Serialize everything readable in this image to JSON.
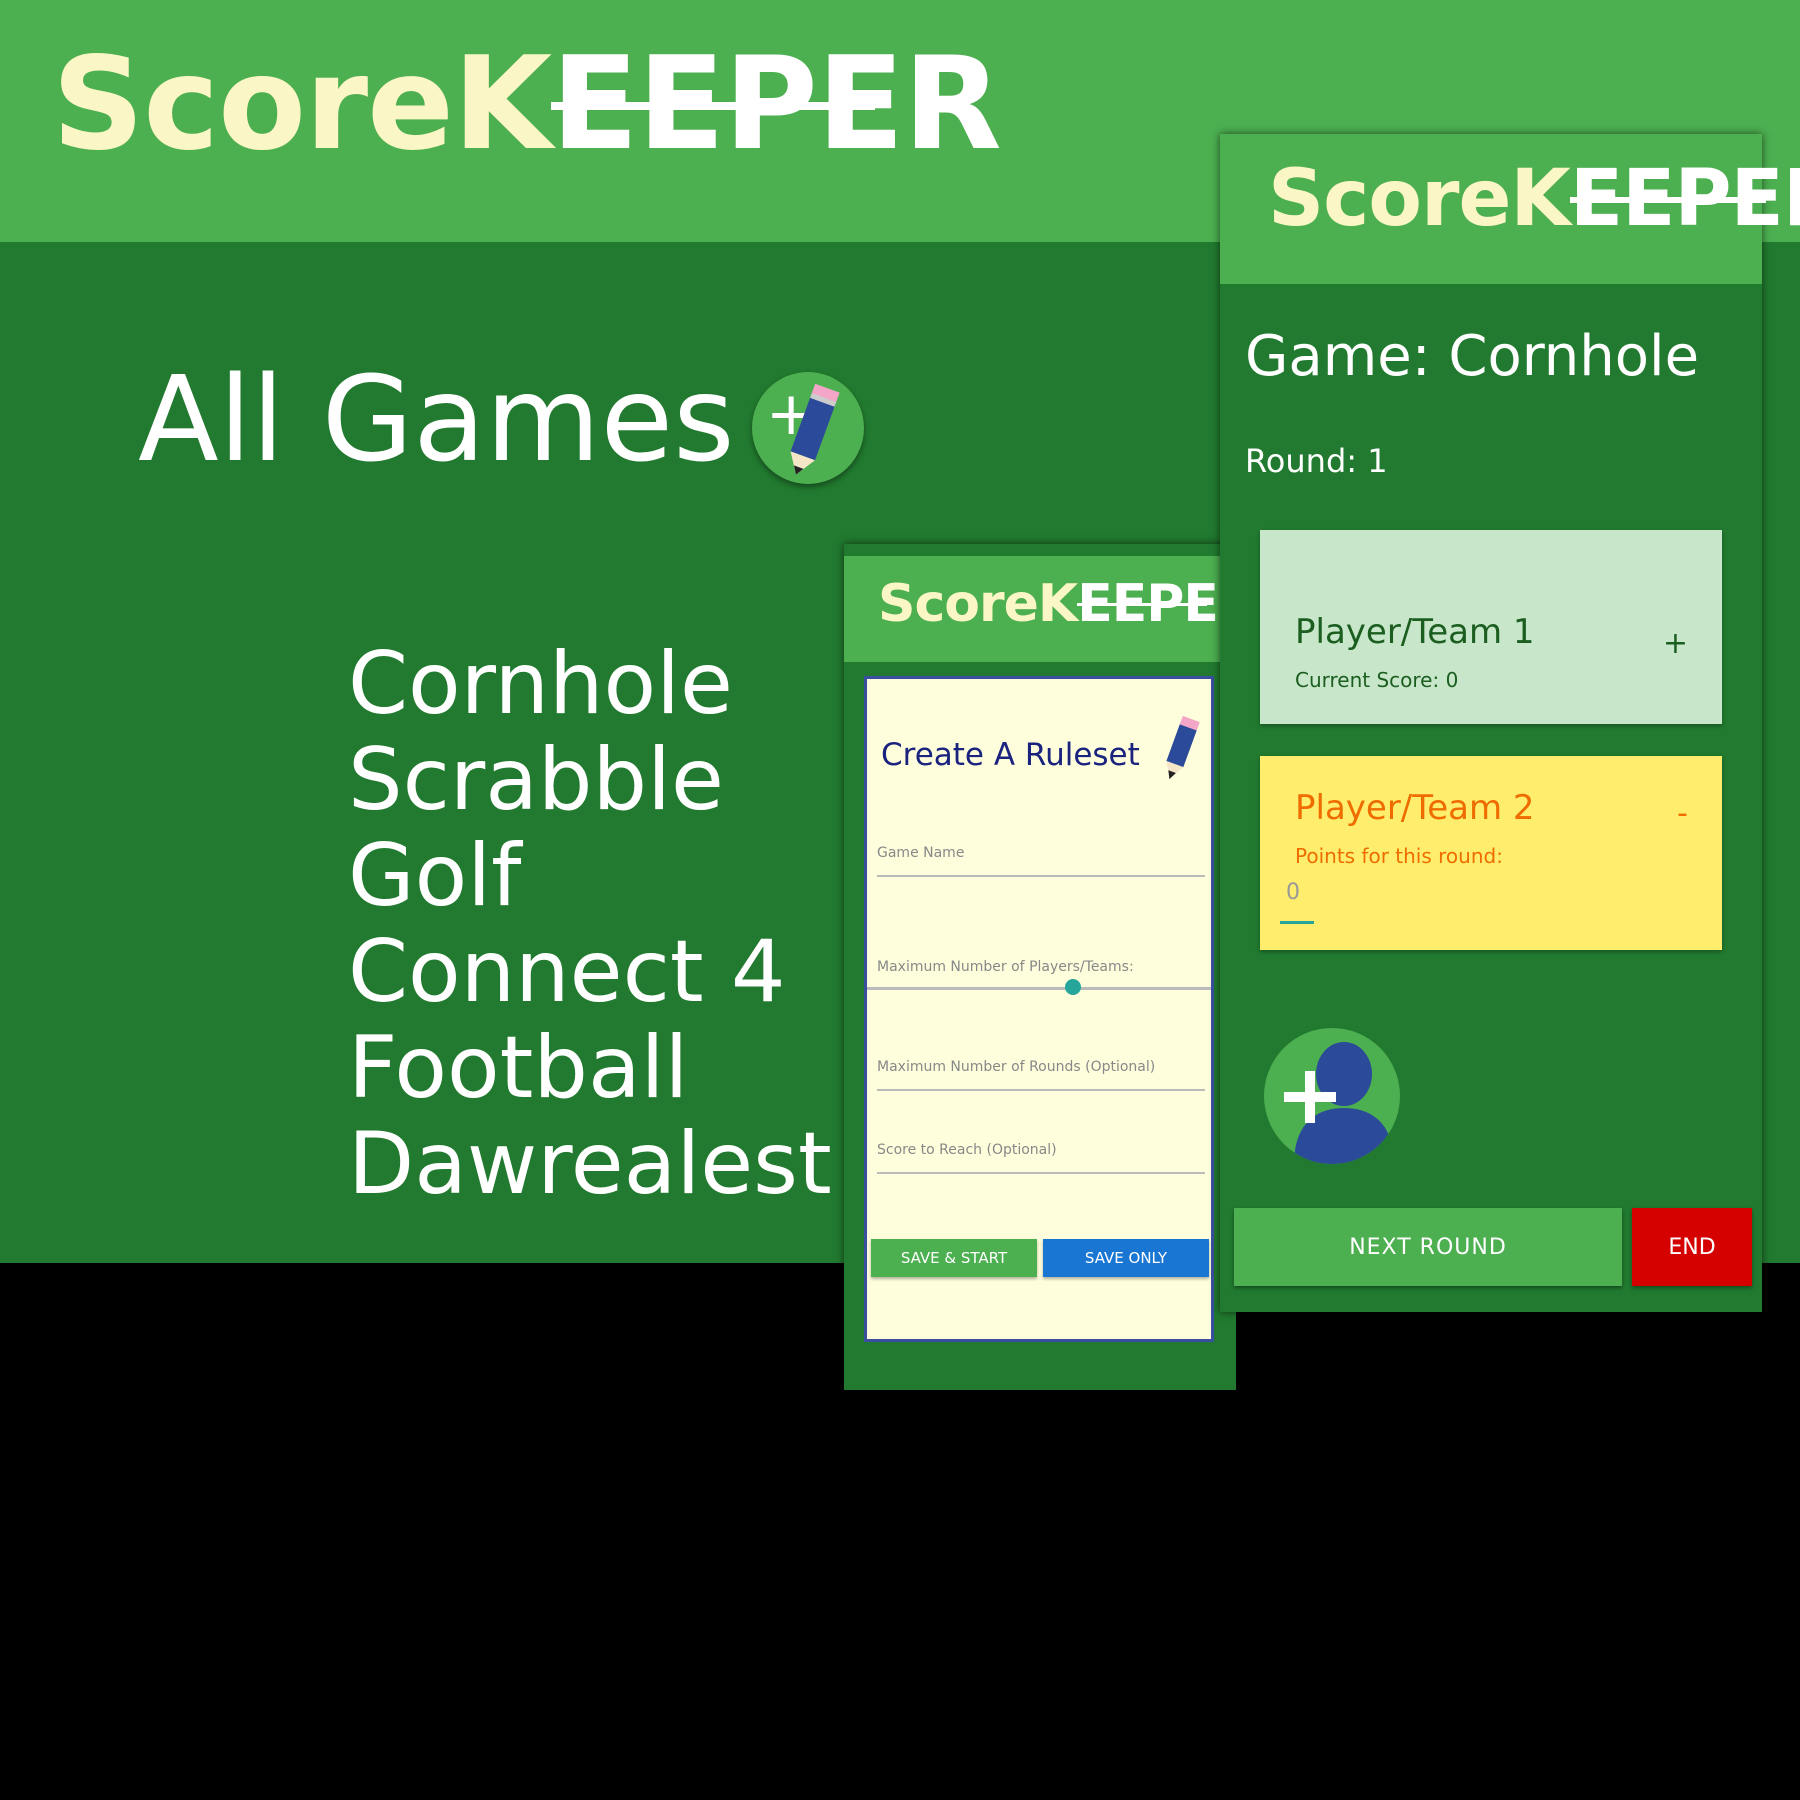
{
  "brand": {
    "part1": "Score",
    "part2": "K",
    "part3": "EEPE",
    "part4": "R"
  },
  "all_games": {
    "title": "All Games",
    "add_icon": "pencil-plus-icon",
    "games": [
      "Cornhole",
      "Scrabble",
      "Golf",
      "Connect 4",
      "Football",
      "Dawrealest"
    ]
  },
  "ruleset": {
    "title": "Create A Ruleset",
    "game_name_label": "Game Name",
    "max_players_label": "Maximum Number of Players/Teams:",
    "max_players_slider_fraction": 0.6,
    "max_rounds_label": "Maximum Number of Rounds (Optional)",
    "score_to_reach_label": "Score to Reach (Optional)",
    "save_start": "SAVE & START",
    "save_only": "SAVE ONLY"
  },
  "game": {
    "title": "Game: Cornhole",
    "round": "Round: 1",
    "players": [
      {
        "name": "Player/Team 1",
        "sub": "Current Score: 0",
        "toggle": "+"
      },
      {
        "name": "Player/Team 2",
        "sub": "Points for this round:",
        "toggle": "-",
        "points_value": "0"
      }
    ],
    "add_player_icon": "add-person-icon",
    "next_round": "NEXT ROUND",
    "end": "END"
  },
  "colors": {
    "header_green": "#4caf50",
    "main_green": "#217a2f",
    "cream": "#fbf6c6",
    "navy": "#1a237e",
    "end_red": "#d50000",
    "save_blue": "#1976d2",
    "player1_bg": "#c8e6c9",
    "player2_bg": "#ffee6e"
  }
}
